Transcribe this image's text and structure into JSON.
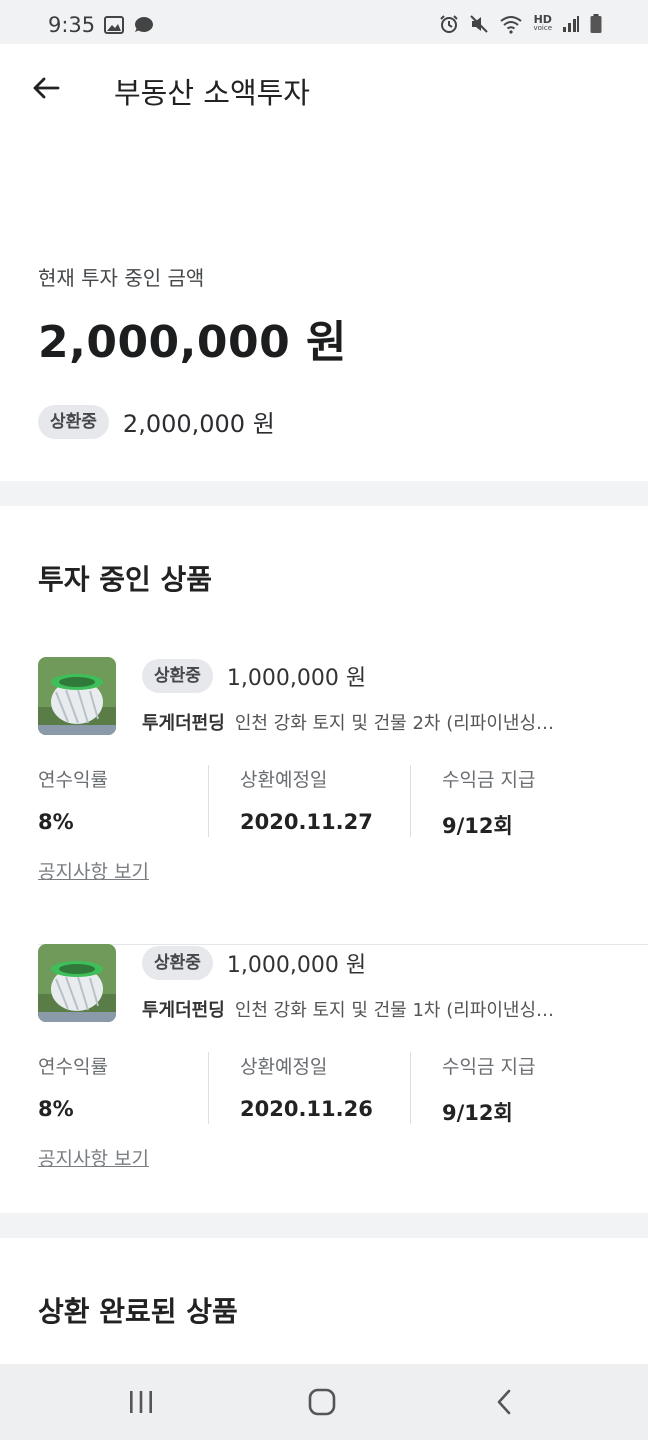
{
  "status_bar": {
    "time": "9:35",
    "left_icons": [
      "image-icon",
      "chat-bubble-icon"
    ],
    "right_icons": [
      "alarm-icon",
      "mute-icon",
      "wifi-icon",
      "hd-voice-icon",
      "signal-icon",
      "battery-icon"
    ],
    "hd_label": "HD",
    "voice_label": "voice"
  },
  "app_bar": {
    "title": "부동산 소액투자"
  },
  "summary": {
    "label": "현재 투자 중인 금액",
    "amount": "2,000,000 원",
    "status_chip": "상환중",
    "status_amount": "2,000,000 원"
  },
  "investing": {
    "section_title": "투자 중인 상품",
    "items": [
      {
        "status": "상환중",
        "amount": "1,000,000 원",
        "platform": "투게더펀딩",
        "name": "인천 강화 토지 및 건물 2차 (리파이낸싱…",
        "stats": [
          {
            "label": "연수익률",
            "value": "8%"
          },
          {
            "label": "상환예정일",
            "value": "2020.11.27"
          },
          {
            "label": "수익금 지급",
            "value": "9/12회"
          }
        ],
        "notice_link": "공지사항 보기"
      },
      {
        "status": "상환중",
        "amount": "1,000,000 원",
        "platform": "투게더펀딩",
        "name": "인천 강화 토지 및 건물 1차 (리파이낸싱…",
        "stats": [
          {
            "label": "연수익률",
            "value": "8%"
          },
          {
            "label": "상환예정일",
            "value": "2020.11.26"
          },
          {
            "label": "수익금 지급",
            "value": "9/12회"
          }
        ],
        "notice_link": "공지사항 보기"
      }
    ]
  },
  "completed": {
    "section_title": "상환 완료된 상품"
  },
  "nav_bar": {
    "buttons": [
      "recent-apps-icon",
      "home-icon",
      "back-nav-icon"
    ]
  },
  "colors": {
    "chip_bg": "#e6e8eb",
    "band_bg": "#f2f3f5",
    "text_primary": "#1b1d1f"
  }
}
